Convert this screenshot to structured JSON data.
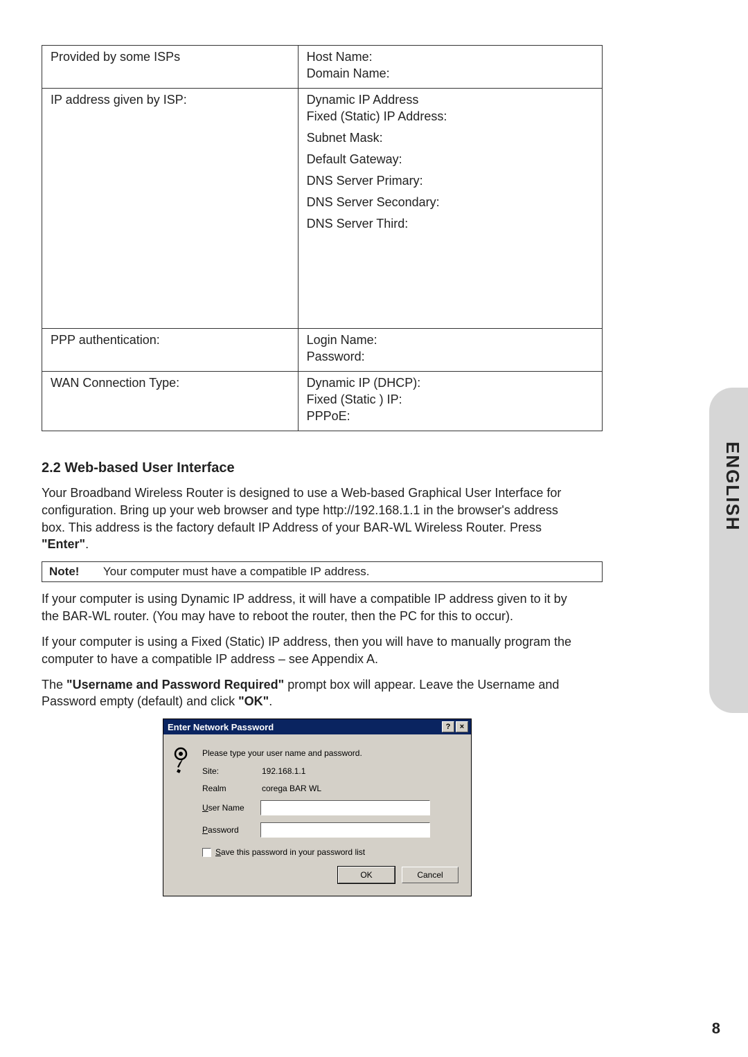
{
  "sideTab": "ENGLISH",
  "pageNumber": "8",
  "table": {
    "rows": [
      {
        "left": "Provided by some ISPs",
        "rightLines": [
          "Host Name:",
          "Domain Name:"
        ]
      },
      {
        "left": "IP address given by ISP:",
        "rightLines": [
          "Dynamic IP Address",
          "Fixed (Static) IP Address:",
          "Subnet Mask:",
          "Default Gateway:",
          "DNS Server Primary:",
          "DNS Server Secondary:",
          "DNS Server Third:"
        ],
        "tall": true
      },
      {
        "left": "PPP authentication:",
        "rightLines": [
          "Login Name:",
          "Password:"
        ]
      },
      {
        "left": "WAN Connection Type:",
        "rightLines": [
          "Dynamic IP (DHCP):",
          "Fixed (Static ) IP:",
          "PPPoE:"
        ]
      }
    ]
  },
  "section": {
    "heading": "2.2 Web-based User Interface",
    "p1a": "Your Broadband Wireless Router is designed to use a Web-based Graphical User Interface for configuration. Bring up your web browser and type http://192.168.1.1 in the browser's address box. This address is the factory default IP Address of your BAR-WL Wireless Router. Press ",
    "p1b": "\"Enter\"",
    "p1c": ".",
    "noteLabel": "Note!",
    "noteText": "Your computer must have a compatible IP address.",
    "p2": "If your computer is using Dynamic IP address, it will have a compatible IP address given to it by the BAR-WL router. (You may have to reboot the router, then the PC for this to occur).",
    "p3": "If your computer is using a Fixed (Static) IP address, then you will have to manually program the computer to have a compatible IP address – see Appendix A.",
    "p4a": "The ",
    "p4b": "\"Username and Password Required\"",
    "p4c": " prompt box will appear. Leave the Username and Password empty (default) and click  ",
    "p4d": "\"OK\"",
    "p4e": "."
  },
  "dialog": {
    "title": "Enter Network Password",
    "help": "?",
    "close": "×",
    "instruction": "Please type your user name and password.",
    "siteLabel": "Site:",
    "siteValue": "192.168.1.1",
    "realmLabel": "Realm",
    "realmValue": "corega BAR WL",
    "userLabelPre": "U",
    "userLabelPost": "ser Name",
    "passLabelPre": "P",
    "passLabelPost": "assword",
    "savePre": "S",
    "savePost": "ave this password in your password list",
    "ok": "OK",
    "cancel": "Cancel"
  }
}
